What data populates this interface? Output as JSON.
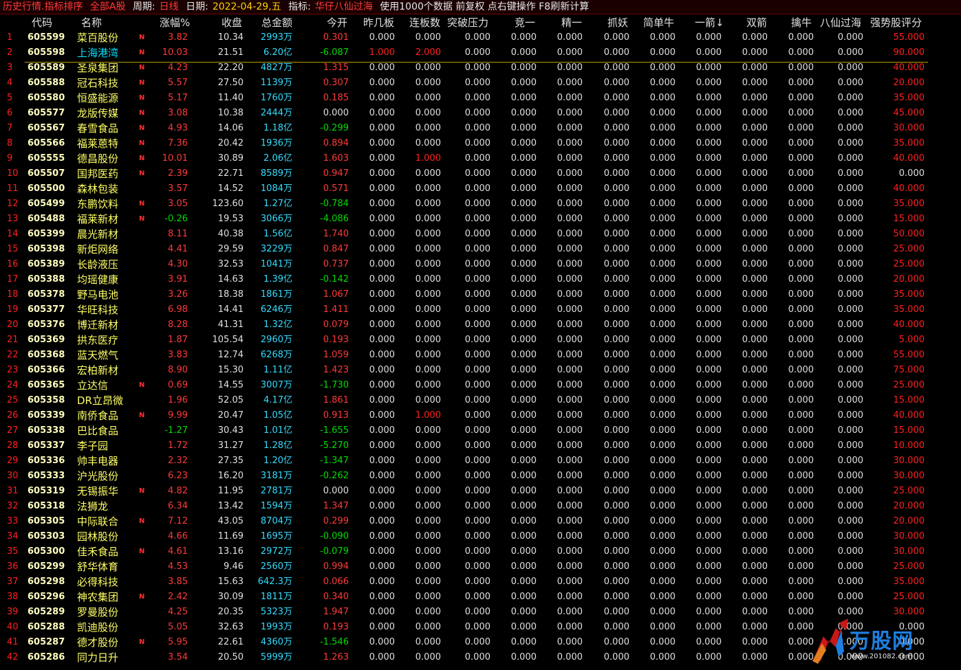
{
  "titlebar": {
    "title": "历史行情.指标排序",
    "scope": "全部A股",
    "period_label": "周期:",
    "period_value": "日线",
    "date_label": "日期:",
    "date_value": "2022-04-29,五",
    "indicator_label": "指标:",
    "indicator_value": "华仔八仙过海",
    "notes": "使用1000个数据 前复权 点右键操作 F8刷新计算"
  },
  "columns": [
    "代码",
    "名称",
    "涨幅%",
    "收盘",
    "总金额",
    "今开",
    "昨几板",
    "连板数",
    "突破压力",
    "竞一",
    "精一",
    "抓妖",
    "简单牛",
    "一箭",
    "双箭",
    "擒牛",
    "八仙过海",
    "强势股评分"
  ],
  "sort_arrow": "↓",
  "rows": [
    [
      "1",
      "605599",
      "菜百股份",
      "N",
      "3.82",
      "10.34",
      "2993万",
      "0.301",
      "0.000",
      "0.000",
      "0.000",
      "0.000",
      "0.000",
      "0.000",
      "0.000",
      "0.000",
      "0.000",
      "0.000",
      "0.000",
      "55.000"
    ],
    [
      "2",
      "605598",
      "上海港湾",
      "N",
      "10.03",
      "21.51",
      "6.20亿",
      "-6.087",
      "1.000",
      "2.000",
      "0.000",
      "0.000",
      "0.000",
      "0.000",
      "0.000",
      "0.000",
      "0.000",
      "0.000",
      "0.000",
      "90.000"
    ],
    [
      "3",
      "605589",
      "圣泉集团",
      "N",
      "4.23",
      "22.20",
      "4827万",
      "1.315",
      "0.000",
      "0.000",
      "0.000",
      "0.000",
      "0.000",
      "0.000",
      "0.000",
      "0.000",
      "0.000",
      "0.000",
      "0.000",
      "40.000"
    ],
    [
      "4",
      "605588",
      "冠石科技",
      "N",
      "5.57",
      "27.50",
      "1139万",
      "0.307",
      "0.000",
      "0.000",
      "0.000",
      "0.000",
      "0.000",
      "0.000",
      "0.000",
      "0.000",
      "0.000",
      "0.000",
      "0.000",
      "20.000"
    ],
    [
      "5",
      "605580",
      "恒盛能源",
      "N",
      "5.17",
      "11.40",
      "1760万",
      "0.185",
      "0.000",
      "0.000",
      "0.000",
      "0.000",
      "0.000",
      "0.000",
      "0.000",
      "0.000",
      "0.000",
      "0.000",
      "0.000",
      "35.000"
    ],
    [
      "6",
      "605577",
      "龙版传媒",
      "N",
      "3.08",
      "10.38",
      "2444万",
      "0.000",
      "0.000",
      "0.000",
      "0.000",
      "0.000",
      "0.000",
      "0.000",
      "0.000",
      "0.000",
      "0.000",
      "0.000",
      "0.000",
      "45.000"
    ],
    [
      "7",
      "605567",
      "春雪食品",
      "N",
      "4.93",
      "14.06",
      "1.18亿",
      "-0.299",
      "0.000",
      "0.000",
      "0.000",
      "0.000",
      "0.000",
      "0.000",
      "0.000",
      "0.000",
      "0.000",
      "0.000",
      "0.000",
      "30.000"
    ],
    [
      "8",
      "605566",
      "福莱蒽特",
      "N",
      "7.36",
      "20.42",
      "1936万",
      "0.894",
      "0.000",
      "0.000",
      "0.000",
      "0.000",
      "0.000",
      "0.000",
      "0.000",
      "0.000",
      "0.000",
      "0.000",
      "0.000",
      "35.000"
    ],
    [
      "9",
      "605555",
      "德昌股份",
      "N",
      "10.01",
      "30.89",
      "2.06亿",
      "1.603",
      "0.000",
      "1.000",
      "0.000",
      "0.000",
      "0.000",
      "0.000",
      "0.000",
      "0.000",
      "0.000",
      "0.000",
      "0.000",
      "40.000"
    ],
    [
      "10",
      "605507",
      "国邦医药",
      "N",
      "2.39",
      "22.71",
      "8589万",
      "0.947",
      "0.000",
      "0.000",
      "0.000",
      "0.000",
      "0.000",
      "0.000",
      "0.000",
      "0.000",
      "0.000",
      "0.000",
      "0.000",
      "0.000"
    ],
    [
      "11",
      "605500",
      "森林包装",
      "",
      "3.57",
      "14.52",
      "1084万",
      "0.571",
      "0.000",
      "0.000",
      "0.000",
      "0.000",
      "0.000",
      "0.000",
      "0.000",
      "0.000",
      "0.000",
      "0.000",
      "0.000",
      "40.000"
    ],
    [
      "12",
      "605499",
      "东鹏饮料",
      "N",
      "3.05",
      "123.60",
      "1.27亿",
      "-0.784",
      "0.000",
      "0.000",
      "0.000",
      "0.000",
      "0.000",
      "0.000",
      "0.000",
      "0.000",
      "0.000",
      "0.000",
      "0.000",
      "35.000"
    ],
    [
      "13",
      "605488",
      "福莱新材",
      "N",
      "-0.26",
      "19.53",
      "3066万",
      "-4.086",
      "0.000",
      "0.000",
      "0.000",
      "0.000",
      "0.000",
      "0.000",
      "0.000",
      "0.000",
      "0.000",
      "0.000",
      "0.000",
      "15.000"
    ],
    [
      "14",
      "605399",
      "晨光新材",
      "",
      "8.11",
      "40.38",
      "1.56亿",
      "1.740",
      "0.000",
      "0.000",
      "0.000",
      "0.000",
      "0.000",
      "0.000",
      "0.000",
      "0.000",
      "0.000",
      "0.000",
      "0.000",
      "50.000"
    ],
    [
      "15",
      "605398",
      "新炬网络",
      "",
      "4.41",
      "29.59",
      "3229万",
      "0.847",
      "0.000",
      "0.000",
      "0.000",
      "0.000",
      "0.000",
      "0.000",
      "0.000",
      "0.000",
      "0.000",
      "0.000",
      "0.000",
      "25.000"
    ],
    [
      "16",
      "605389",
      "长龄液压",
      "",
      "4.30",
      "32.53",
      "1041万",
      "0.737",
      "0.000",
      "0.000",
      "0.000",
      "0.000",
      "0.000",
      "0.000",
      "0.000",
      "0.000",
      "0.000",
      "0.000",
      "0.000",
      "25.000"
    ],
    [
      "17",
      "605388",
      "均瑶健康",
      "",
      "3.91",
      "14.63",
      "1.39亿",
      "-0.142",
      "0.000",
      "0.000",
      "0.000",
      "0.000",
      "0.000",
      "0.000",
      "0.000",
      "0.000",
      "0.000",
      "0.000",
      "0.000",
      "20.000"
    ],
    [
      "18",
      "605378",
      "野马电池",
      "",
      "3.26",
      "18.38",
      "1861万",
      "1.067",
      "0.000",
      "0.000",
      "0.000",
      "0.000",
      "0.000",
      "0.000",
      "0.000",
      "0.000",
      "0.000",
      "0.000",
      "0.000",
      "35.000"
    ],
    [
      "19",
      "605377",
      "华旺科技",
      "",
      "6.98",
      "14.41",
      "6246万",
      "1.411",
      "0.000",
      "0.000",
      "0.000",
      "0.000",
      "0.000",
      "0.000",
      "0.000",
      "0.000",
      "0.000",
      "0.000",
      "0.000",
      "35.000"
    ],
    [
      "20",
      "605376",
      "博迁新材",
      "",
      "8.28",
      "41.31",
      "1.32亿",
      "0.079",
      "0.000",
      "0.000",
      "0.000",
      "0.000",
      "0.000",
      "0.000",
      "0.000",
      "0.000",
      "0.000",
      "0.000",
      "0.000",
      "40.000"
    ],
    [
      "21",
      "605369",
      "拱东医疗",
      "",
      "1.87",
      "105.54",
      "2960万",
      "0.193",
      "0.000",
      "0.000",
      "0.000",
      "0.000",
      "0.000",
      "0.000",
      "0.000",
      "0.000",
      "0.000",
      "0.000",
      "0.000",
      "5.000"
    ],
    [
      "22",
      "605368",
      "蓝天燃气",
      "",
      "3.83",
      "12.74",
      "6268万",
      "1.059",
      "0.000",
      "0.000",
      "0.000",
      "0.000",
      "0.000",
      "0.000",
      "0.000",
      "0.000",
      "0.000",
      "0.000",
      "0.000",
      "55.000"
    ],
    [
      "23",
      "605366",
      "宏柏新材",
      "",
      "8.90",
      "15.30",
      "1.11亿",
      "1.423",
      "0.000",
      "0.000",
      "0.000",
      "0.000",
      "0.000",
      "0.000",
      "0.000",
      "0.000",
      "0.000",
      "0.000",
      "0.000",
      "75.000"
    ],
    [
      "24",
      "605365",
      "立达信",
      "N",
      "0.69",
      "14.55",
      "3007万",
      "-1.730",
      "0.000",
      "0.000",
      "0.000",
      "0.000",
      "0.000",
      "0.000",
      "0.000",
      "0.000",
      "0.000",
      "0.000",
      "0.000",
      "25.000"
    ],
    [
      "25",
      "605358",
      "DR立昂微",
      "",
      "1.96",
      "52.05",
      "4.17亿",
      "1.861",
      "0.000",
      "0.000",
      "0.000",
      "0.000",
      "0.000",
      "0.000",
      "0.000",
      "0.000",
      "0.000",
      "0.000",
      "0.000",
      "15.000"
    ],
    [
      "26",
      "605339",
      "南侨食品",
      "N",
      "9.99",
      "20.47",
      "1.05亿",
      "0.913",
      "0.000",
      "1.000",
      "0.000",
      "0.000",
      "0.000",
      "0.000",
      "0.000",
      "0.000",
      "0.000",
      "0.000",
      "0.000",
      "40.000"
    ],
    [
      "27",
      "605338",
      "巴比食品",
      "",
      "-1.27",
      "30.43",
      "1.01亿",
      "-1.655",
      "0.000",
      "0.000",
      "0.000",
      "0.000",
      "0.000",
      "0.000",
      "0.000",
      "0.000",
      "0.000",
      "0.000",
      "0.000",
      "15.000"
    ],
    [
      "28",
      "605337",
      "李子园",
      "",
      "1.72",
      "31.27",
      "1.28亿",
      "-5.270",
      "0.000",
      "0.000",
      "0.000",
      "0.000",
      "0.000",
      "0.000",
      "0.000",
      "0.000",
      "0.000",
      "0.000",
      "0.000",
      "10.000"
    ],
    [
      "29",
      "605336",
      "帅丰电器",
      "",
      "2.32",
      "27.35",
      "1.20亿",
      "-1.347",
      "0.000",
      "0.000",
      "0.000",
      "0.000",
      "0.000",
      "0.000",
      "0.000",
      "0.000",
      "0.000",
      "0.000",
      "0.000",
      "30.000"
    ],
    [
      "30",
      "605333",
      "沪光股份",
      "",
      "6.23",
      "16.20",
      "3181万",
      "-0.262",
      "0.000",
      "0.000",
      "0.000",
      "0.000",
      "0.000",
      "0.000",
      "0.000",
      "0.000",
      "0.000",
      "0.000",
      "0.000",
      "30.000"
    ],
    [
      "31",
      "605319",
      "无锡振华",
      "N",
      "4.82",
      "11.95",
      "2781万",
      "0.000",
      "0.000",
      "0.000",
      "0.000",
      "0.000",
      "0.000",
      "0.000",
      "0.000",
      "0.000",
      "0.000",
      "0.000",
      "0.000",
      "25.000"
    ],
    [
      "32",
      "605318",
      "法狮龙",
      "",
      "6.34",
      "13.42",
      "1594万",
      "1.347",
      "0.000",
      "0.000",
      "0.000",
      "0.000",
      "0.000",
      "0.000",
      "0.000",
      "0.000",
      "0.000",
      "0.000",
      "0.000",
      "20.000"
    ],
    [
      "33",
      "605305",
      "中际联合",
      "N",
      "7.12",
      "43.05",
      "8704万",
      "0.299",
      "0.000",
      "0.000",
      "0.000",
      "0.000",
      "0.000",
      "0.000",
      "0.000",
      "0.000",
      "0.000",
      "0.000",
      "0.000",
      "20.000"
    ],
    [
      "34",
      "605303",
      "园林股份",
      "",
      "4.66",
      "11.69",
      "1695万",
      "-0.090",
      "0.000",
      "0.000",
      "0.000",
      "0.000",
      "0.000",
      "0.000",
      "0.000",
      "0.000",
      "0.000",
      "0.000",
      "0.000",
      "30.000"
    ],
    [
      "35",
      "605300",
      "佳禾食品",
      "N",
      "4.61",
      "13.16",
      "2972万",
      "-0.079",
      "0.000",
      "0.000",
      "0.000",
      "0.000",
      "0.000",
      "0.000",
      "0.000",
      "0.000",
      "0.000",
      "0.000",
      "0.000",
      "30.000"
    ],
    [
      "36",
      "605299",
      "舒华体育",
      "",
      "4.53",
      "9.46",
      "2560万",
      "0.994",
      "0.000",
      "0.000",
      "0.000",
      "0.000",
      "0.000",
      "0.000",
      "0.000",
      "0.000",
      "0.000",
      "0.000",
      "0.000",
      "25.000"
    ],
    [
      "37",
      "605298",
      "必得科技",
      "",
      "3.85",
      "15.63",
      "642.3万",
      "0.066",
      "0.000",
      "0.000",
      "0.000",
      "0.000",
      "0.000",
      "0.000",
      "0.000",
      "0.000",
      "0.000",
      "0.000",
      "0.000",
      "35.000"
    ],
    [
      "38",
      "605296",
      "神农集团",
      "N",
      "2.42",
      "30.09",
      "1811万",
      "0.340",
      "0.000",
      "0.000",
      "0.000",
      "0.000",
      "0.000",
      "0.000",
      "0.000",
      "0.000",
      "0.000",
      "0.000",
      "0.000",
      "25.000"
    ],
    [
      "39",
      "605289",
      "罗曼股份",
      "",
      "4.25",
      "20.35",
      "5323万",
      "1.947",
      "0.000",
      "0.000",
      "0.000",
      "0.000",
      "0.000",
      "0.000",
      "0.000",
      "0.000",
      "0.000",
      "0.000",
      "0.000",
      "30.000"
    ],
    [
      "40",
      "605288",
      "凯迪股份",
      "",
      "5.05",
      "32.63",
      "1993万",
      "0.193",
      "0.000",
      "0.000",
      "0.000",
      "0.000",
      "0.000",
      "0.000",
      "0.000",
      "0.000",
      "0.000",
      "0.000",
      "0.000",
      "0.000"
    ],
    [
      "41",
      "605287",
      "德才股份",
      "N",
      "5.95",
      "22.61",
      "4360万",
      "-1.546",
      "0.000",
      "0.000",
      "0.000",
      "0.000",
      "0.000",
      "0.000",
      "0.000",
      "0.000",
      "0.000",
      "0.000",
      "0.000",
      "0.000"
    ],
    [
      "42",
      "605286",
      "同力日升",
      "",
      "3.54",
      "20.50",
      "5999万",
      "1.263",
      "0.000",
      "0.000",
      "0.000",
      "0.000",
      "0.000",
      "0.000",
      "0.000",
      "0.000",
      "0.000",
      "0.000",
      "0.000",
      "0.000"
    ]
  ],
  "watermark": {
    "logo_text": "万股网",
    "url": "www.201082.com"
  },
  "colors": {
    "up": "#ff3a3a",
    "down": "#00dd00",
    "amount": "#33ddff",
    "name": "#ffff66",
    "highlight_name": "#00e0ff",
    "background": "#000000"
  }
}
